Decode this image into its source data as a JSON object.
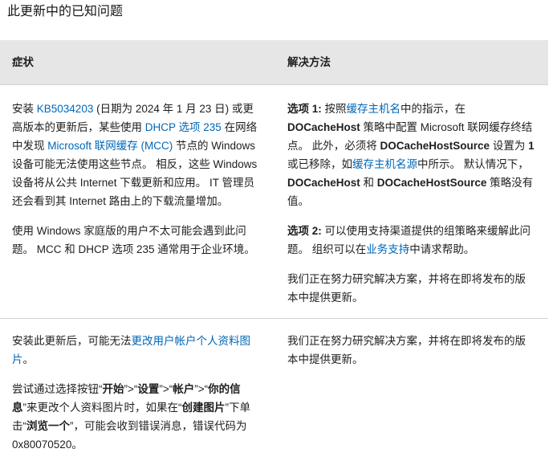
{
  "page": {
    "title": "此更新中的已知问题"
  },
  "table": {
    "headers": {
      "symptom": "症状",
      "workaround": "解决方法"
    },
    "row1": {
      "symptom_p1": {
        "t1": "安装 ",
        "kb_link": "KB5034203",
        "t2": " (日期为 2024 年 1 月 23 日) 或更高版本的更新后，某些使用 ",
        "dhcp_link": "DHCP 选项 235",
        "t3": " 在网络中发现 ",
        "mcc_link": "Microsoft 联网缓存 (MCC)",
        "t4": " 节点的 Windows 设备可能无法使用这些节点。 相反，这些 Windows 设备将从公共 Internet 下载更新和应用。 IT 管理员还会看到其 Internet 路由上的下载流量增加。"
      },
      "symptom_p2": "使用 Windows 家庭版的用户不太可能会遇到此问题。 MCC 和 DHCP 选项 235 通常用于企业环境。",
      "workaround_p1": {
        "b1": "选项 1:",
        "t1": " 按照",
        "cache_host_link": "缓存主机名",
        "t2": "中的指示，在 ",
        "b2": "DOCacheHost",
        "t3": " 策略中配置 Microsoft 联网缓存终结点。 此外，必须将 ",
        "b3": "DOCacheHostSource",
        "t4": " 设置为 ",
        "b4": "1",
        "t5": " 或已移除，如",
        "cache_source_link": "缓存主机名源",
        "t6": "中所示。 默认情况下，",
        "b5": "DOCacheHost",
        "t7": " 和 ",
        "b6": "DOCacheHostSource",
        "t8": " 策略没有值。"
      },
      "workaround_p2": {
        "b1": "选项 2:",
        "t1": " 可以使用支持渠道提供的组策略来缓解此问题。 组织可以在",
        "support_link": "业务支持",
        "t2": "中请求帮助。"
      },
      "workaround_p3": "我们正在努力研究解决方案，并将在即将发布的版本中提供更新。"
    },
    "row2": {
      "symptom_p1": {
        "t1": "安装此更新后，可能无法",
        "profile_link": "更改用户帐户个人资料图片",
        "t2": "。"
      },
      "symptom_p2": {
        "t1": "尝试通过选择按钮“",
        "b1": "开始",
        "t2": "”>“",
        "b2": "设置",
        "t3": "”>“",
        "b3": "帐户",
        "t4": "”>“",
        "b4": "你的信息",
        "t5": "”来更改个人资料图片时，如果在“",
        "b5": "创建图片",
        "t6": "”下单击“",
        "b6": "浏览一个",
        "t7": "”，可能会收到错误消息，错误代码为 0x80070520。"
      },
      "workaround_p1": "我们正在努力研究解决方案，并将在即将发布的版本中提供更新。"
    }
  },
  "colors": {
    "link": "#0067b8",
    "header_bg": "#e6e6e6",
    "border": "#d2d2d2"
  }
}
